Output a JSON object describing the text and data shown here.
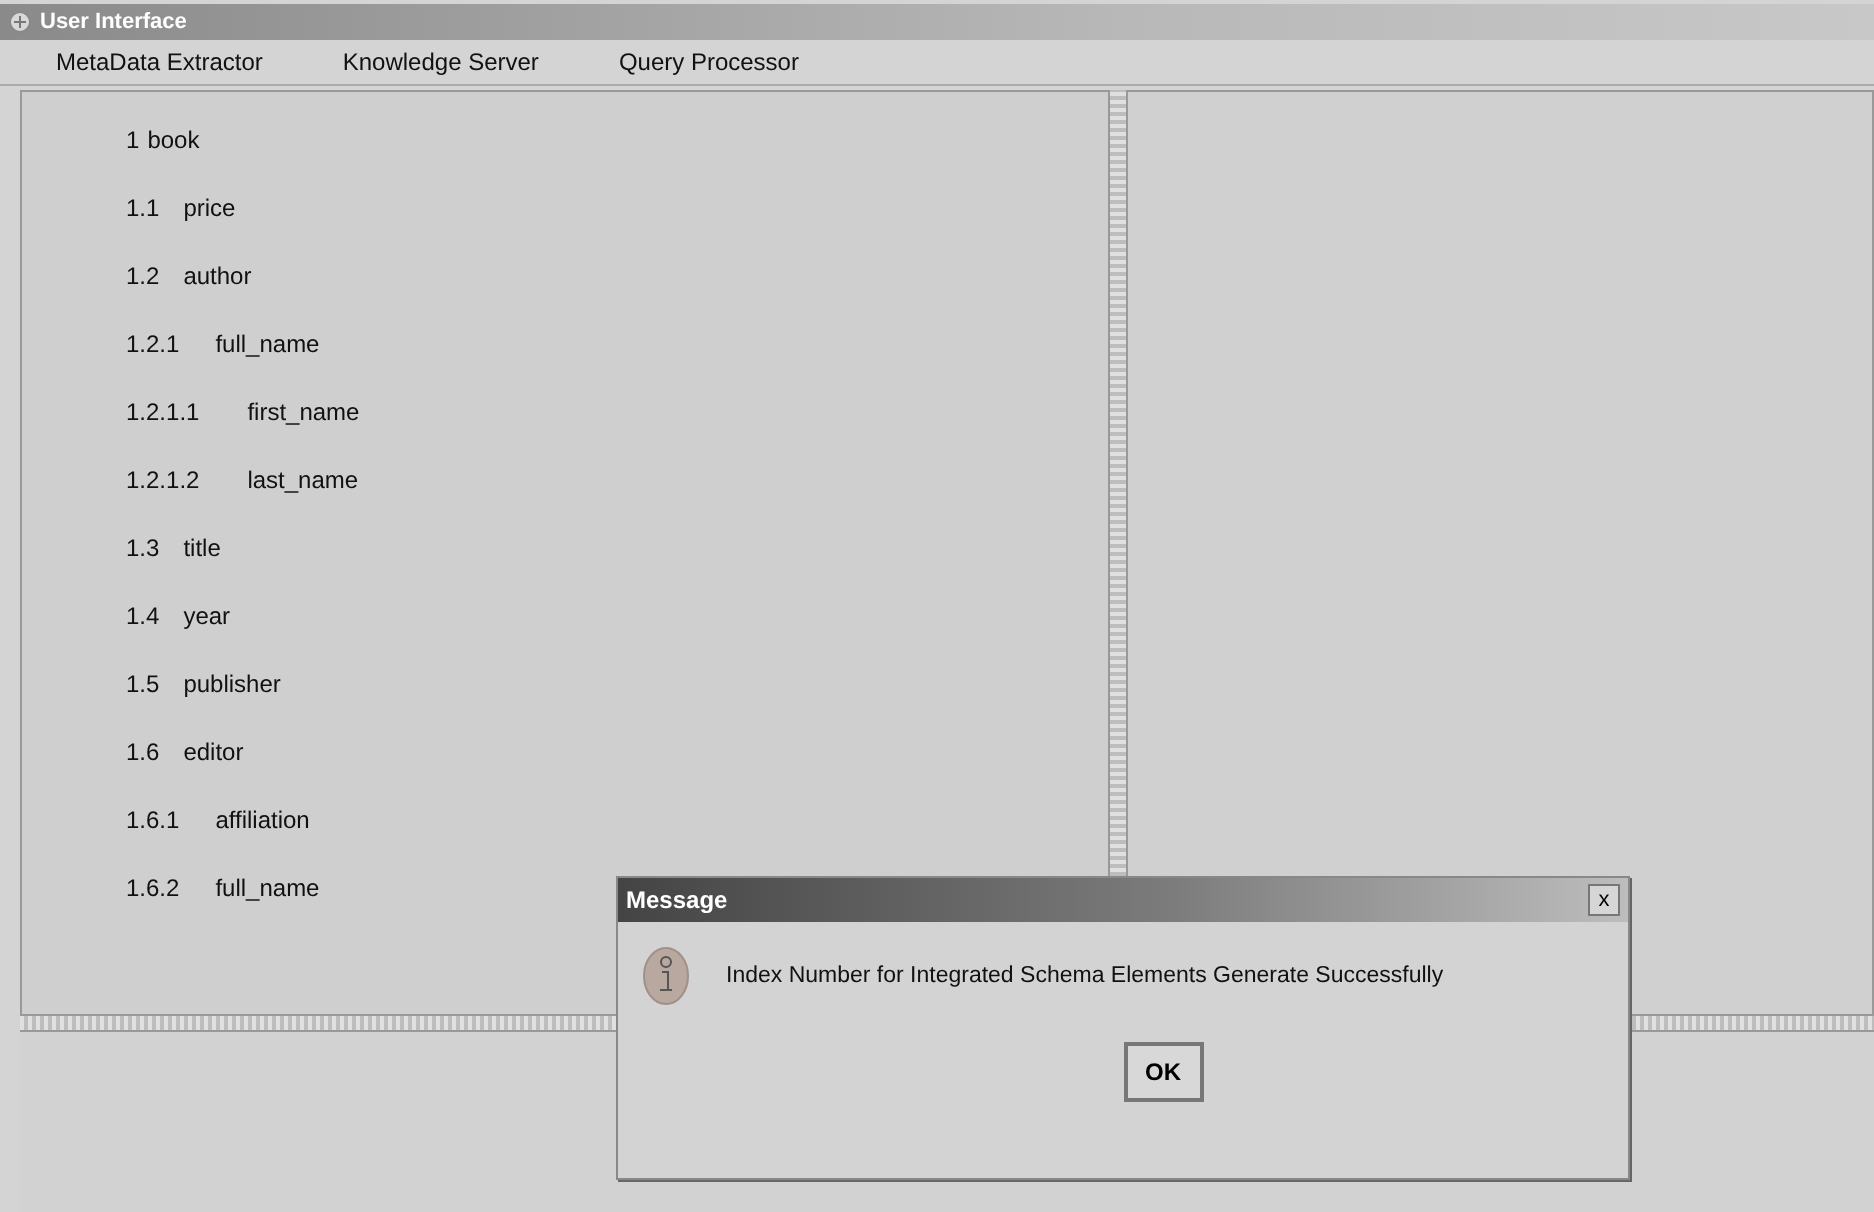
{
  "window": {
    "title": "User Interface"
  },
  "menu": [
    {
      "label": "MetaData Extractor"
    },
    {
      "label": "Knowledge Server"
    },
    {
      "label": "Query Processor"
    }
  ],
  "tree": [
    {
      "number": "1",
      "label": "book",
      "children": [
        {
          "number": "1.1",
          "label": "price"
        },
        {
          "number": "1.2",
          "label": "author",
          "children": [
            {
              "number": "1.2.1",
              "label": "full_name",
              "children": [
                {
                  "number": "1.2.1.1",
                  "label": "first_name"
                },
                {
                  "number": "1.2.1.2",
                  "label": "last_name"
                }
              ]
            }
          ]
        },
        {
          "number": "1.3",
          "label": "title"
        },
        {
          "number": "1.4",
          "label": "year"
        },
        {
          "number": "1.5",
          "label": "publisher"
        },
        {
          "number": "1.6",
          "label": "editor",
          "children": [
            {
              "number": "1.6.1",
              "label": "affiliation"
            },
            {
              "number": "1.6.2",
              "label": "full_name"
            }
          ]
        }
      ]
    }
  ],
  "dialog": {
    "title": "Message",
    "close": "x",
    "message": "Index Number for Integrated Schema Elements Generate Successfully",
    "button": "OK"
  }
}
